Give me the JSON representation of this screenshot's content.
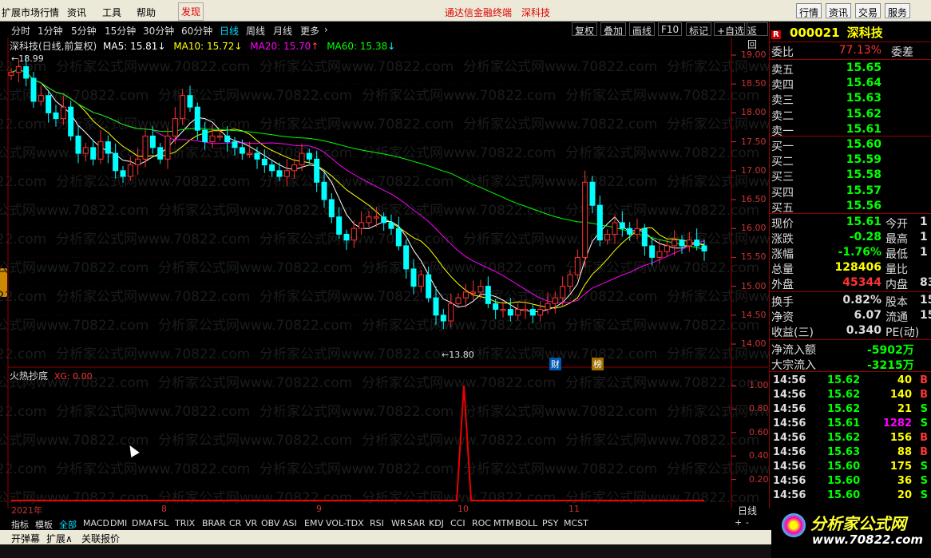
{
  "menu": {
    "items": [
      "扩展市场行情",
      "资讯",
      "工具",
      "帮助"
    ],
    "discover": "发现",
    "center_title": "通达信金融终端",
    "stock_tag": "深科技",
    "right_buttons": [
      "行情",
      "资讯",
      "交易",
      "服务"
    ]
  },
  "periods": {
    "items": [
      "分时",
      "1分钟",
      "5分钟",
      "15分钟",
      "30分钟",
      "60分钟",
      "日线",
      "周线",
      "月线",
      "更多"
    ],
    "active": "日线",
    "arrow": "›"
  },
  "toolbar": {
    "items": [
      "复权",
      "叠加",
      "画线",
      "F10",
      "标记",
      "+自选",
      "返回"
    ]
  },
  "legend": {
    "name": "深科技(日线,前复权)",
    "ma5": "MA5: 15.81",
    "ma10": "MA10: 15.72",
    "ma20": "MA20: 15.70",
    "ma60": "MA60: 15.38",
    "ma5_arrow": "↓",
    "ma10_arrow": "↓",
    "ma20_arrow": "↑",
    "ma60_arrow": "↓"
  },
  "price_labels": [
    "19.00",
    "18.50",
    "18.00",
    "17.50",
    "17.00",
    "16.50",
    "16.00",
    "15.50",
    "15.00",
    "14.50",
    "14.00"
  ],
  "markers": {
    "high": "18.99",
    "low": "13.80",
    "cai": "财",
    "bang": "榜"
  },
  "indicator": {
    "title": "火热抄底",
    "xg": "XG: 0.00",
    "labels": [
      "1.00",
      "0.80",
      "0.60",
      "0.40",
      "0.20"
    ]
  },
  "dates": {
    "y2021": "2021年",
    "m8": "8",
    "m9": "9",
    "m10": "10",
    "m11": "11",
    "period": "日线"
  },
  "tabs": {
    "items": [
      "指标",
      "模板",
      "全部",
      "MACD",
      "DMI",
      "DMA",
      "FSL",
      "TRIX",
      "BRAR",
      "CR",
      "VR",
      "OBV",
      "ASI",
      "EMV",
      "VOL-TDX",
      "RSI",
      "WR",
      "SAR",
      "KDJ",
      "CCI",
      "ROC",
      "MTM",
      "BOLL",
      "PSY",
      "MCST"
    ],
    "active": "全部",
    "plus": "+",
    "minus": "-"
  },
  "statusbar": {
    "items": [
      "开弹幕",
      "扩展∧",
      "关联报价"
    ]
  },
  "stock": {
    "badge": "R",
    "code": "000021",
    "name": "深科技"
  },
  "orderbook": {
    "ratio_label": "委比",
    "ratio": "77.13%",
    "diff_label": "委差",
    "sells": [
      {
        "label": "卖五",
        "price": "15.65"
      },
      {
        "label": "卖四",
        "price": "15.64"
      },
      {
        "label": "卖三",
        "price": "15.63"
      },
      {
        "label": "卖二",
        "price": "15.62"
      },
      {
        "label": "卖一",
        "price": "15.61"
      }
    ],
    "buys": [
      {
        "label": "买一",
        "price": "15.60"
      },
      {
        "label": "买二",
        "price": "15.59"
      },
      {
        "label": "买三",
        "price": "15.58"
      },
      {
        "label": "买四",
        "price": "15.57"
      },
      {
        "label": "买五",
        "price": "15.56"
      }
    ]
  },
  "quote": [
    {
      "l": "现价",
      "v": "15.61",
      "l2": "今开",
      "v2": "1"
    },
    {
      "l": "涨跌",
      "v": "-0.28",
      "l2": "最高",
      "v2": "1"
    },
    {
      "l": "涨幅",
      "v": "-1.76%",
      "l2": "最低",
      "v2": "1"
    },
    {
      "l": "总量",
      "v": "128406",
      "l2": "量比",
      "v2": ""
    },
    {
      "l": "外盘",
      "v": "45344",
      "l2": "内盘",
      "v2": "83"
    }
  ],
  "fund": [
    {
      "l": "换手",
      "v": "0.82%",
      "l2": "股本",
      "v2": "15"
    },
    {
      "l": "净资",
      "v": "6.07",
      "l2": "流通",
      "v2": "15"
    },
    {
      "l": "收益(三)",
      "v": "0.340",
      "l2": "PE(动)",
      "v2": ""
    }
  ],
  "flow": [
    {
      "l": "净流入额",
      "v": "-5902万"
    },
    {
      "l": "大宗流入",
      "v": "-3215万"
    }
  ],
  "ticks": [
    {
      "t": "14:56",
      "p": "15.62",
      "q": "40",
      "s": "B"
    },
    {
      "t": "14:56",
      "p": "15.62",
      "q": "140",
      "s": "B"
    },
    {
      "t": "14:56",
      "p": "15.62",
      "q": "21",
      "s": "S"
    },
    {
      "t": "14:56",
      "p": "15.61",
      "q": "1282",
      "s": "S"
    },
    {
      "t": "14:56",
      "p": "15.62",
      "q": "156",
      "s": "B"
    },
    {
      "t": "14:56",
      "p": "15.63",
      "q": "88",
      "s": "B"
    },
    {
      "t": "14:56",
      "p": "15.60",
      "q": "175",
      "s": "S"
    },
    {
      "t": "14:56",
      "p": "15.60",
      "q": "36",
      "s": "S"
    },
    {
      "t": "14:56",
      "p": "15.60",
      "q": "20",
      "s": "S"
    }
  ],
  "logo": {
    "cn": "分析家公式网",
    "url": "www.70822.com"
  },
  "watermark": "分析家公式网www.70822.com",
  "colors": {
    "up": "#ff3232",
    "down": "#00ffff",
    "ma5": "#ffffff",
    "ma10": "#ffff00",
    "ma20": "#ff00ff",
    "ma60": "#00ff00"
  }
}
